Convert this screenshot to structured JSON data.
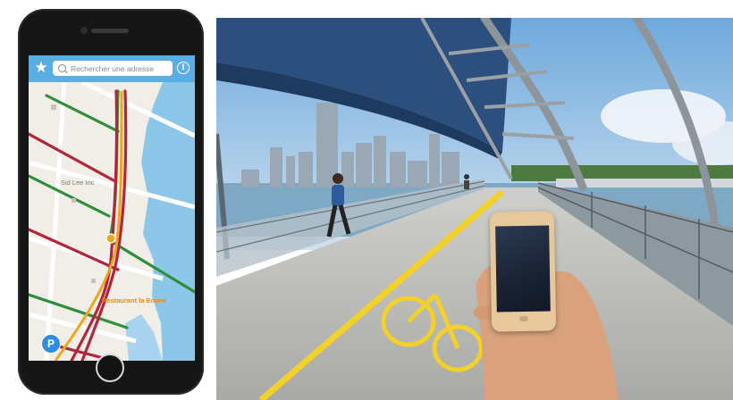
{
  "map_app": {
    "search": {
      "placeholder": "Rechercher une adresse"
    },
    "icons": {
      "favorites": "star-icon",
      "search": "search-icon",
      "info": "info-icon",
      "parking": "parking-icon"
    },
    "pois": [
      {
        "label": "Sid Lee Inc"
      },
      {
        "label": "Restaurant la Emme"
      }
    ],
    "parking_label": "P",
    "colors": {
      "header": "#5aaee2",
      "water": "#8cc7ea",
      "route_green": "#2f8f3c",
      "route_red": "#b0263a",
      "route_orange": "#f0a422",
      "parking": "#2f8ee0"
    }
  },
  "photo": {
    "subject": "person holding smartphone on bridge walkway"
  }
}
